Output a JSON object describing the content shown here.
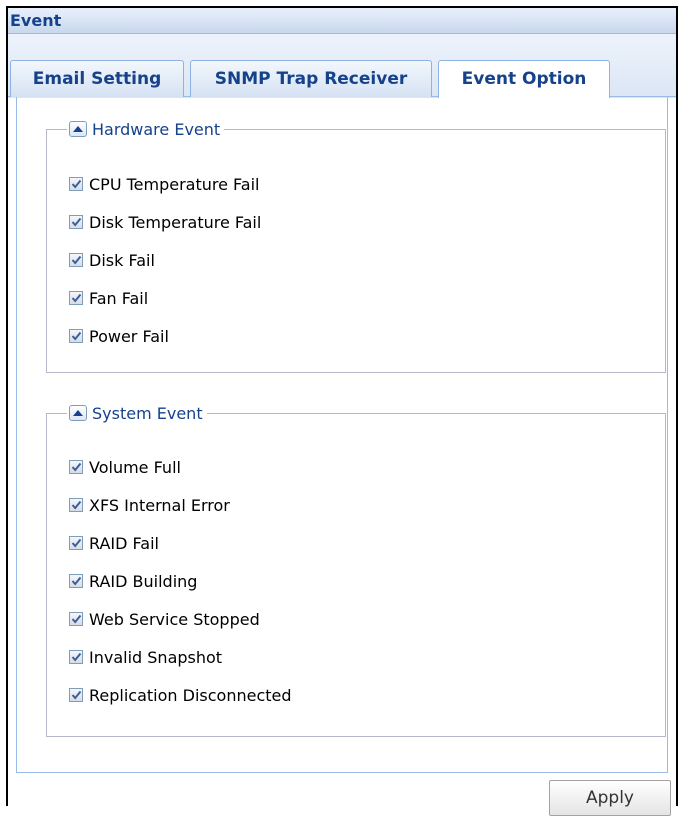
{
  "window": {
    "title": "Event"
  },
  "tabs": [
    {
      "label": "Email Setting",
      "active": false
    },
    {
      "label": "SNMP Trap Receiver",
      "active": false
    },
    {
      "label": "Event Option",
      "active": true
    }
  ],
  "groups": [
    {
      "legend": "Hardware Event",
      "icon": "collapse-up-icon",
      "items": [
        {
          "label": "CPU Temperature Fail",
          "checked": true
        },
        {
          "label": "Disk Temperature Fail",
          "checked": true
        },
        {
          "label": "Disk Fail",
          "checked": true
        },
        {
          "label": "Fan Fail",
          "checked": true
        },
        {
          "label": "Power Fail",
          "checked": true
        }
      ]
    },
    {
      "legend": "System Event",
      "icon": "collapse-up-icon",
      "items": [
        {
          "label": "Volume Full",
          "checked": true
        },
        {
          "label": "XFS Internal Error",
          "checked": true
        },
        {
          "label": "RAID Fail",
          "checked": true
        },
        {
          "label": "RAID Building",
          "checked": true
        },
        {
          "label": "Web Service Stopped",
          "checked": true
        },
        {
          "label": "Invalid Snapshot",
          "checked": true
        },
        {
          "label": "Replication Disconnected",
          "checked": true
        }
      ]
    }
  ],
  "footer": {
    "apply_label": "Apply"
  },
  "colors": {
    "accent": "#15428b",
    "border": "#99bbe8"
  }
}
